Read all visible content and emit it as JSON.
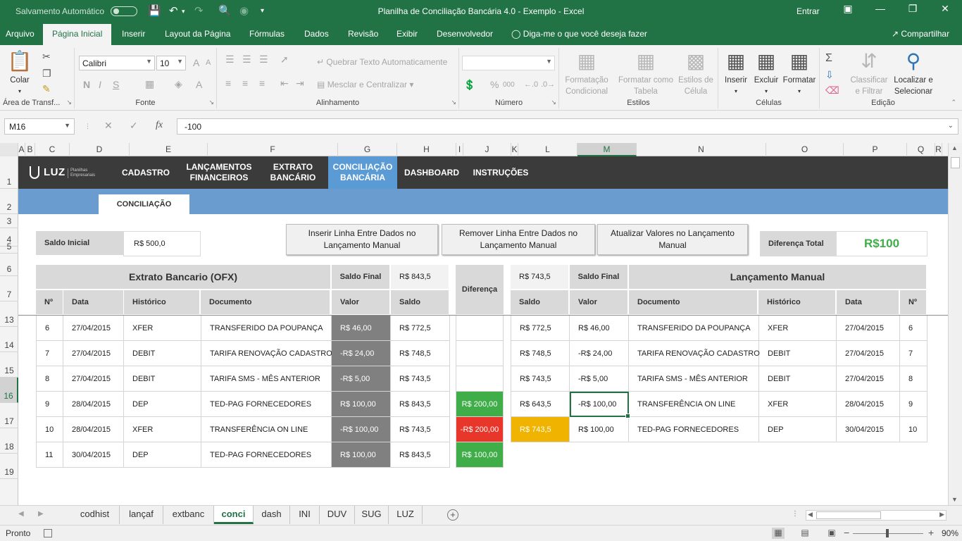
{
  "titlebar": {
    "autosave_label": "Salvamento Automático",
    "title": "Planilha de Conciliação Bancária 4.0 - Exemplo  -  Excel",
    "signin": "Entrar"
  },
  "ribbon_tabs": [
    {
      "label": "Arquivo"
    },
    {
      "label": "Página Inicial"
    },
    {
      "label": "Inserir"
    },
    {
      "label": "Layout da Página"
    },
    {
      "label": "Fórmulas"
    },
    {
      "label": "Dados"
    },
    {
      "label": "Revisão"
    },
    {
      "label": "Exibir"
    },
    {
      "label": "Desenvolvedor"
    }
  ],
  "tellme": "Diga-me o que você deseja fazer",
  "share": "Compartilhar",
  "ribbon": {
    "clipboard": {
      "paste": "Colar",
      "group": "Área de Transf..."
    },
    "font": {
      "name": "Calibri",
      "size": "10",
      "bold": "N",
      "italic": "I",
      "underline": "S",
      "grow": "A",
      "shrink": "A",
      "fontcolor": "A",
      "group": "Fonte"
    },
    "alignment": {
      "wrap": "Quebrar Texto Automaticamente",
      "merge": "Mesclar e Centralizar",
      "group": "Alinhamento"
    },
    "number": {
      "percent": "%",
      "comma": "000",
      "group": "Número"
    },
    "styles": {
      "conditional": "Formatação Condicional",
      "as_table": "Formatar como Tabela",
      "cell_styles": "Estilos de Célula",
      "group": "Estilos"
    },
    "cells": {
      "insert": "Inserir",
      "delete": "Excluir",
      "format": "Formatar",
      "group": "Células"
    },
    "editing": {
      "sort": "Classificar e Filtrar",
      "find": "Localizar e Selecionar",
      "group": "Edição"
    }
  },
  "formula_bar": {
    "name_box": "M16",
    "fx": "fx",
    "value": "-100"
  },
  "columns": [
    "A",
    "B",
    "C",
    "D",
    "E",
    "F",
    "G",
    "H",
    "I",
    "J",
    "K",
    "L",
    "M",
    "N",
    "O",
    "P",
    "Q",
    "R"
  ],
  "rows": [
    "1",
    "2",
    "3",
    "4",
    "5",
    "6",
    "7",
    "13",
    "14",
    "15",
    "16",
    "17",
    "18",
    "19"
  ],
  "nav": {
    "logo": "LUZ",
    "logo_sub": "Planilhas Empresariais",
    "items": [
      {
        "label": "CADASTRO"
      },
      {
        "label": "LANÇAMENTOS\nFINANCEIROS"
      },
      {
        "label": "EXTRATO\nBANCÁRIO"
      },
      {
        "label": "CONCILIAÇÃO\nBANCÁRIA"
      },
      {
        "label": "DASHBOARD"
      },
      {
        "label": "INSTRUÇÕES"
      }
    ],
    "subtab": "CONCILIAÇÃO"
  },
  "sheet": {
    "saldo_inicial_label": "Saldo Inicial",
    "saldo_inicial_value": "R$ 500,0",
    "buttons": [
      "Inserir Linha Entre Dados no Lançamento Manual",
      "Remover Linha Entre Dados no Lançamento Manual",
      "Atualizar Valores no Lançamento Manual"
    ],
    "diferenca_total_label": "Diferença Total",
    "diferenca_total_value": "R$100",
    "accent_green": "#3fae49"
  },
  "extrato": {
    "title": "Extrato Bancario (OFX)",
    "saldo_final_label": "Saldo Final",
    "saldo_final_value": "R$ 843,5",
    "headers": [
      "Nº",
      "Data",
      "Histórico",
      "Documento",
      "Valor",
      "Saldo"
    ],
    "rows": [
      [
        "6",
        "27/04/2015",
        "XFER",
        "TRANSFERIDO DA POUPANÇA",
        "R$ 46,00",
        "R$ 772,5"
      ],
      [
        "7",
        "27/04/2015",
        "DEBIT",
        "TARIFA RENOVAÇÃO CADASTRO",
        "-R$ 24,00",
        "R$ 748,5"
      ],
      [
        "8",
        "27/04/2015",
        "DEBIT",
        "TARIFA SMS - MÊS ANTERIOR",
        "-R$ 5,00",
        "R$ 743,5"
      ],
      [
        "9",
        "28/04/2015",
        "DEP",
        "TED-PAG FORNECEDORES",
        "R$ 100,00",
        "R$ 843,5"
      ],
      [
        "10",
        "28/04/2015",
        "XFER",
        "TRANSFERÊNCIA ON LINE",
        "-R$ 100,00",
        "R$ 743,5"
      ],
      [
        "11",
        "30/04/2015",
        "DEP",
        "TED-PAG FORNECEDORES",
        "R$ 100,00",
        "R$ 843,5"
      ]
    ]
  },
  "diferenca": {
    "header": "Diferença",
    "values": [
      "",
      "",
      "",
      "R$ 200,00",
      "-R$ 200,00",
      "R$ 100,00"
    ],
    "colors": [
      "",
      "",
      "",
      "#3fae49",
      "#e8362b",
      "#3fae49"
    ]
  },
  "manual": {
    "title": "Lançamento Manual",
    "saldo_top": "R$ 743,5",
    "saldo_final_label": "Saldo Final",
    "headers": [
      "Saldo",
      "Valor",
      "Documento",
      "Histórico",
      "Data",
      "Nº"
    ],
    "rows": [
      [
        "R$ 772,5",
        "R$ 46,00",
        "TRANSFERIDO DA POUPANÇA",
        "XFER",
        "27/04/2015",
        "6"
      ],
      [
        "R$ 748,5",
        "-R$ 24,00",
        "TARIFA RENOVAÇÃO CADASTRO",
        "DEBIT",
        "27/04/2015",
        "7"
      ],
      [
        "R$ 743,5",
        "-R$ 5,00",
        "TARIFA SMS - MÊS ANTERIOR",
        "DEBIT",
        "27/04/2015",
        "8"
      ],
      [
        "R$ 643,5",
        "-R$ 100,00",
        "TRANSFERÊNCIA ON LINE",
        "XFER",
        "28/04/2015",
        "9"
      ],
      [
        "R$ 743,5",
        "R$ 100,00",
        "TED-PAG FORNECEDORES",
        "DEP",
        "30/04/2015",
        "10"
      ]
    ],
    "highlight_color": "#f0b400"
  },
  "sheet_tabs": [
    "codhist",
    "lançaf",
    "extbanc",
    "conci",
    "dash",
    "INI",
    "DUV",
    "SUG",
    "LUZ"
  ],
  "active_sheet": "conci",
  "status": {
    "ready": "Pronto",
    "zoom": "90%"
  }
}
